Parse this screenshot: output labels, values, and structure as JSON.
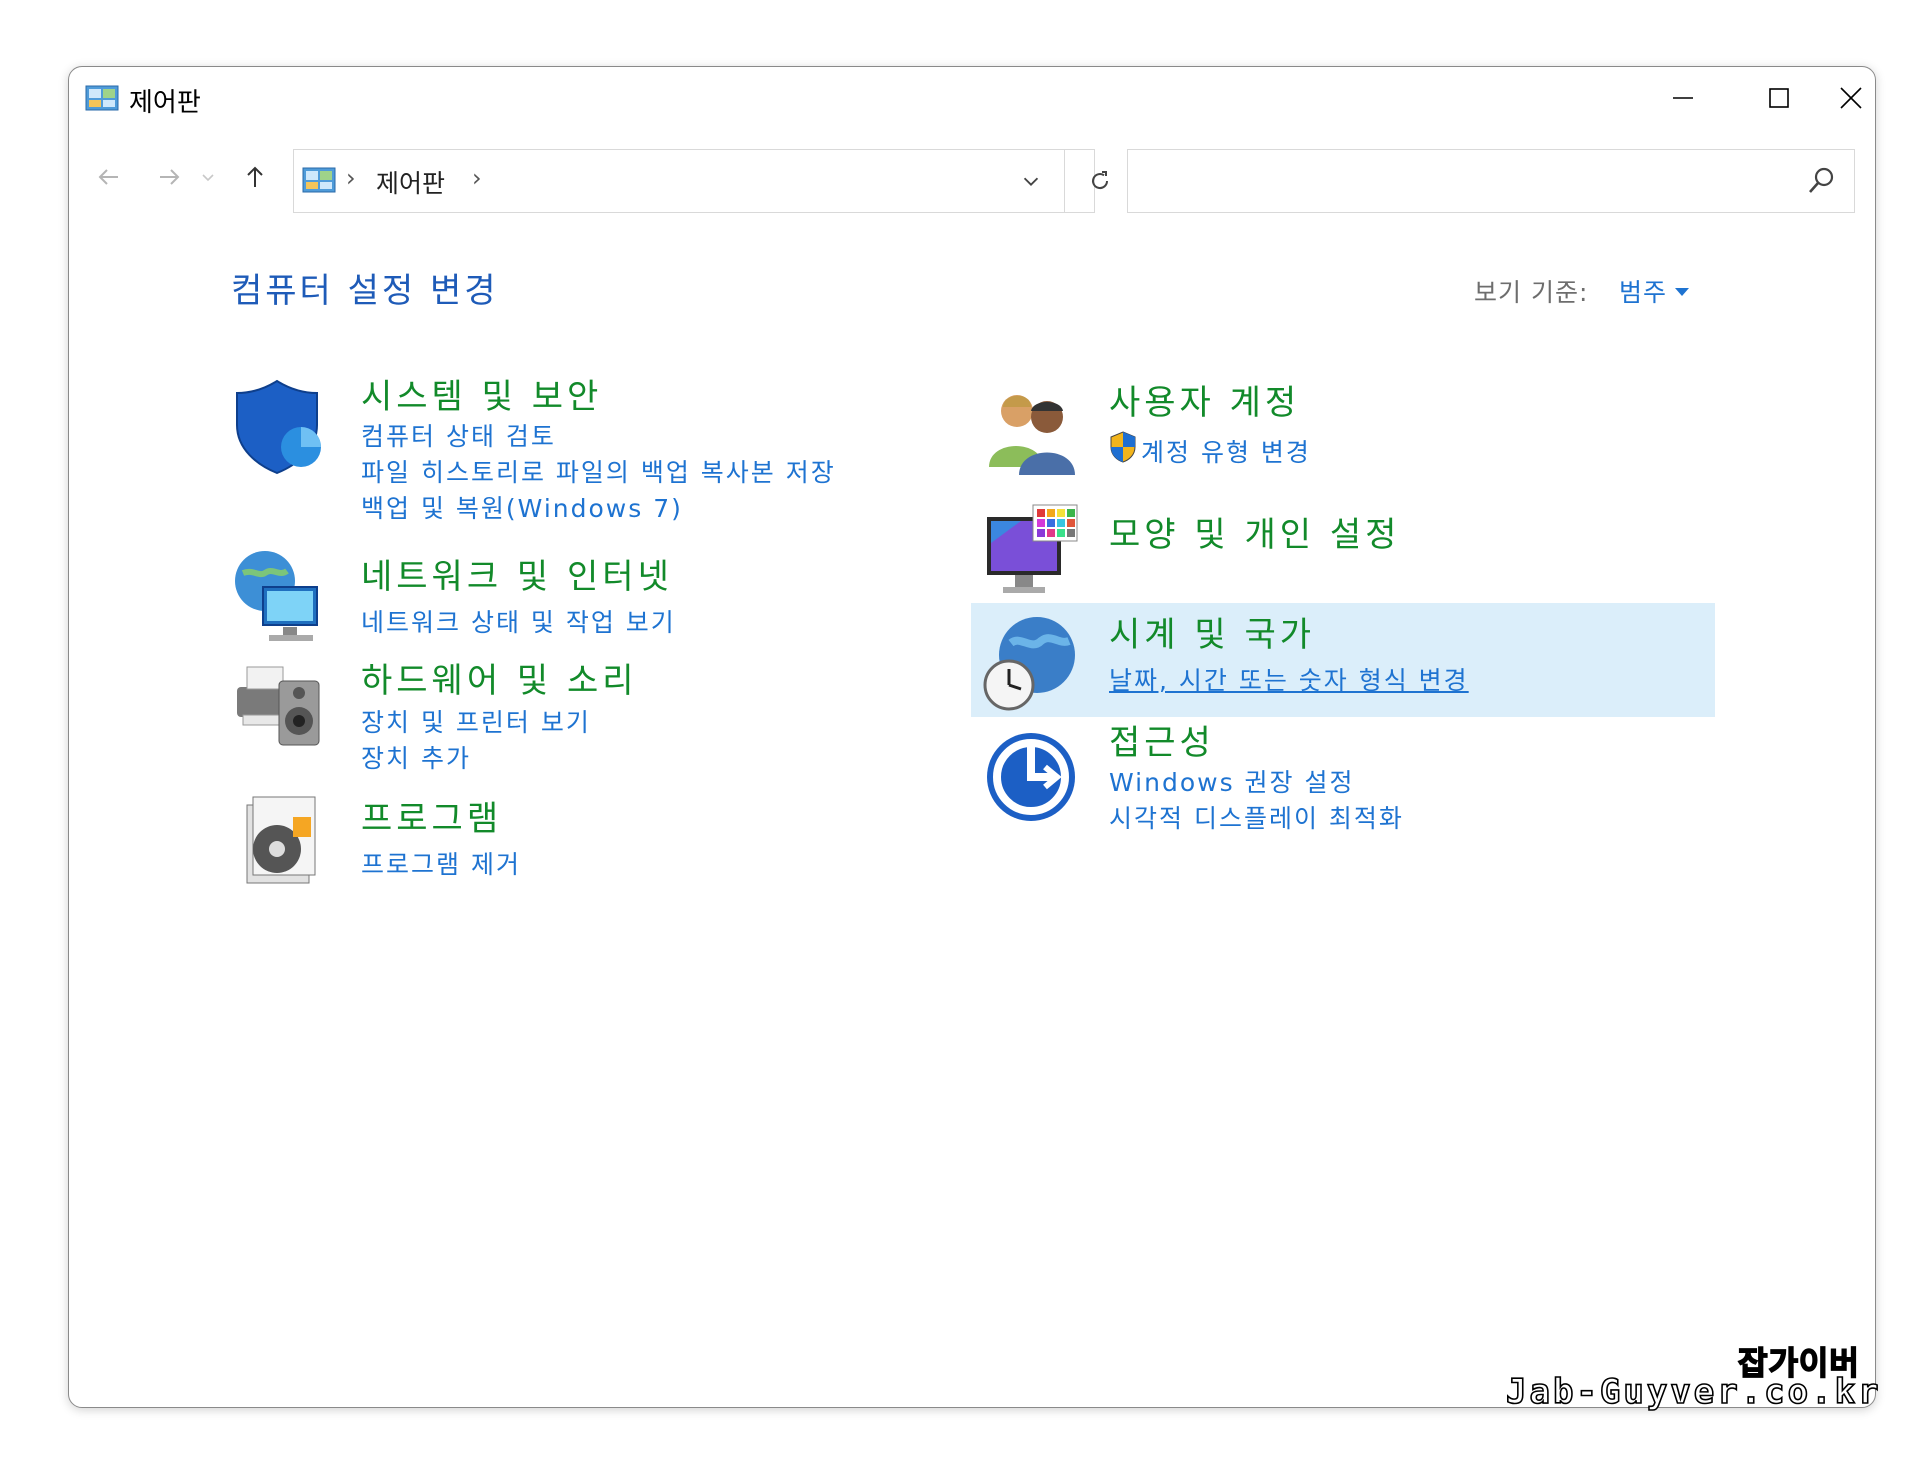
{
  "window": {
    "title": "제어판"
  },
  "nav": {
    "breadcrumb": "제어판",
    "separator": "›",
    "search_value": ""
  },
  "content": {
    "title": "컴퓨터 설정 변경",
    "view_by_label": "보기 기준:",
    "view_by_value": "범주"
  },
  "categories": {
    "system": {
      "title": "시스템 및 보안",
      "links": [
        "컴퓨터 상태 검토",
        "파일 히스토리로 파일의 백업 복사본 저장",
        "백업 및 복원(Windows 7)"
      ],
      "icon": "shield-icon"
    },
    "network": {
      "title": "네트워크 및 인터넷",
      "links": [
        "네트워크 상태 및 작업 보기"
      ],
      "icon": "network-globe-icon"
    },
    "hardware": {
      "title": "하드웨어 및 소리",
      "links": [
        "장치 및 프린터 보기",
        "장치 추가"
      ],
      "icon": "printer-speaker-icon"
    },
    "programs": {
      "title": "프로그램",
      "links": [
        "프로그램 제거"
      ],
      "icon": "programs-disc-icon"
    },
    "users": {
      "title": "사용자 계정",
      "links": [
        "계정 유형 변경"
      ],
      "icon": "users-icon"
    },
    "appearance": {
      "title": "모양 및 개인 설정",
      "links": [],
      "icon": "monitor-palette-icon"
    },
    "clock": {
      "title": "시계 및 국가",
      "links": [
        "날짜, 시간 또는 숫자 형식 변경"
      ],
      "icon": "globe-clock-icon"
    },
    "access": {
      "title": "접근성",
      "links": [
        "Windows 권장 설정",
        "시각적 디스플레이 최적화"
      ],
      "icon": "accessibility-icon"
    }
  },
  "watermark": {
    "line1": "잡가이버",
    "line2": "Jab-Guyver.co.kr"
  },
  "colors": {
    "link": "#1e73d1",
    "heading_green": "#128a2a",
    "title_blue": "#1e5bb8",
    "highlight": "#dbeefa"
  }
}
